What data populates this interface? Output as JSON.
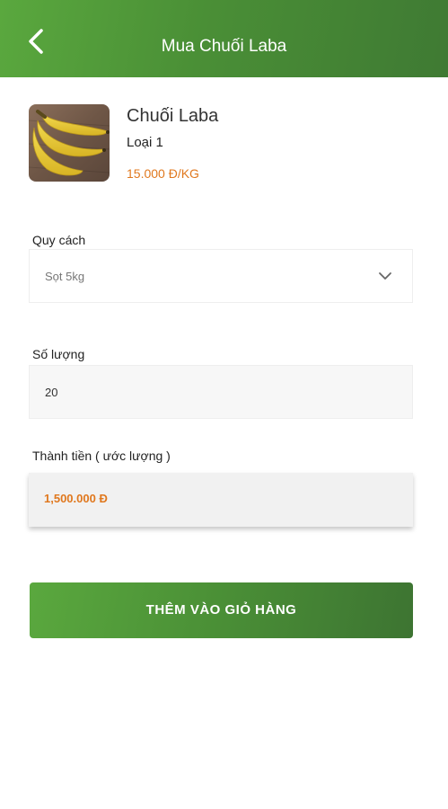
{
  "header": {
    "title": "Mua Chuối Laba",
    "back_icon": "chevron-left-icon"
  },
  "product": {
    "name": "Chuối Laba",
    "type": "Loại 1",
    "price": "15.000 Đ/KG",
    "image": "banana-bunch-photo"
  },
  "form": {
    "spec_label": "Quy cách",
    "spec_value": "Sọt 5kg",
    "spec_icon": "chevron-down-icon",
    "qty_label": "Số lượng",
    "qty_value": "20",
    "total_label": "Thành tiền ( ước lượng )",
    "total_value": "1,500.000 Đ"
  },
  "actions": {
    "add_to_cart_label": "THÊM VÀO GIỎ HÀNG"
  },
  "colors": {
    "brand_green": "#4a8f36",
    "price_orange": "#e0781e"
  }
}
